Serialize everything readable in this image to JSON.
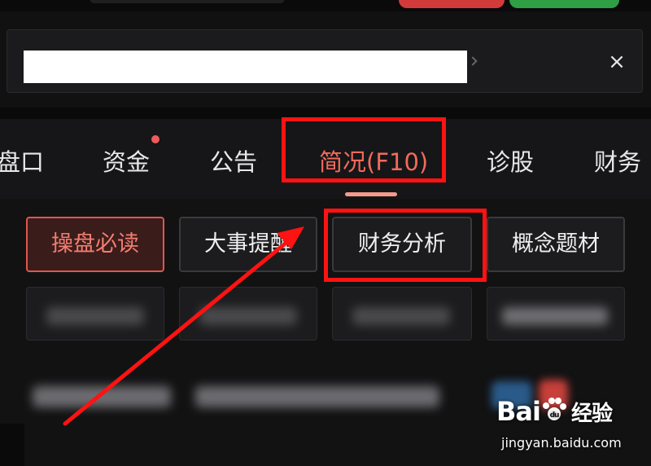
{
  "tabs": [
    {
      "label": "盘口",
      "active": false,
      "dot": false
    },
    {
      "label": "资金",
      "active": false,
      "dot": true
    },
    {
      "label": "公告",
      "active": false,
      "dot": false
    },
    {
      "label": "简况(F10)",
      "active": true,
      "dot": false
    },
    {
      "label": "诊股",
      "active": false,
      "dot": false
    },
    {
      "label": "财务",
      "active": false,
      "dot": false
    }
  ],
  "sub_tabs": [
    {
      "label": "操盘必读",
      "active": true
    },
    {
      "label": "大事提醒",
      "active": false
    },
    {
      "label": "财务分析",
      "active": false
    },
    {
      "label": "概念题材",
      "active": false
    }
  ],
  "search": {
    "close_glyph": "×"
  },
  "colors": {
    "accent": "#f26a5b",
    "annotation": "#ff1212",
    "background": "#111112"
  },
  "watermark": {
    "logo_prefix": "Bai",
    "logo_suffix": "经验",
    "url": "jingyan.baidu.com"
  }
}
